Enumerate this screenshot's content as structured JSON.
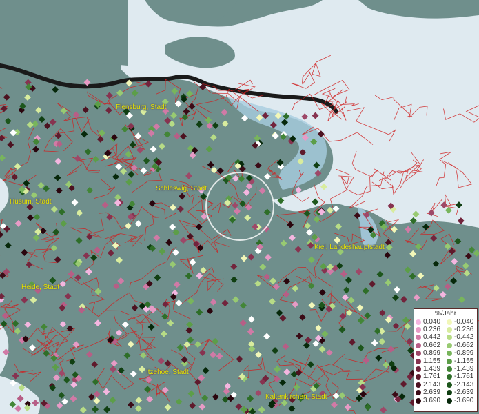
{
  "map": {
    "cities": [
      {
        "id": "flensburg",
        "label": "Flensburg, Stadt"
      },
      {
        "id": "schleswig",
        "label": "Schleswig, Stadt"
      },
      {
        "id": "husum",
        "label": "Husum, Stadt"
      },
      {
        "id": "kiel",
        "label": "Kiel, Landeshauptstadt"
      },
      {
        "id": "heide",
        "label": "Heide, Stadt"
      },
      {
        "id": "itzehoe",
        "label": "Itzehoe, Stadt"
      },
      {
        "id": "kaltenkirchen",
        "label": "Kaltenkirchen, Stadt"
      }
    ],
    "colors": {
      "land": "#6f8f8c",
      "sea": "#dfeaf0",
      "shallow_sea": "#a8cde0",
      "border_line": "#1a1a1a",
      "district_lines": "#d02020",
      "label_color": "#e6e600"
    }
  },
  "legend": {
    "title": "%/Jahr",
    "positive": [
      {
        "value": "0.040",
        "color": "#f4b6e0"
      },
      {
        "value": "0.236",
        "color": "#e79bc6"
      },
      {
        "value": "0.442",
        "color": "#d17aa6"
      },
      {
        "value": "0.662",
        "color": "#b75e86"
      },
      {
        "value": "0.899",
        "color": "#9e4868"
      },
      {
        "value": "1.155",
        "color": "#873350"
      },
      {
        "value": "1.439",
        "color": "#72243c"
      },
      {
        "value": "1.761",
        "color": "#5f1a2c"
      },
      {
        "value": "2.143",
        "color": "#4c1220"
      },
      {
        "value": "2.639",
        "color": "#3b0b16"
      },
      {
        "value": "3.690",
        "color": "#2a050d"
      }
    ],
    "negative": [
      {
        "value": "-0.040",
        "color": "#f2f7b8"
      },
      {
        "value": "-0.236",
        "color": "#d8ec9e"
      },
      {
        "value": "-0.442",
        "color": "#b7dc86"
      },
      {
        "value": "-0.662",
        "color": "#98ca72"
      },
      {
        "value": "-0.899",
        "color": "#78b55c"
      },
      {
        "value": "-1.155",
        "color": "#5c9e48"
      },
      {
        "value": "-1.439",
        "color": "#438637"
      },
      {
        "value": "-1.761",
        "color": "#2e6e28"
      },
      {
        "value": "-2.143",
        "color": "#1d561c"
      },
      {
        "value": "-2.639",
        "color": "#103f12"
      },
      {
        "value": "-3.690",
        "color": "#06280a"
      }
    ]
  }
}
